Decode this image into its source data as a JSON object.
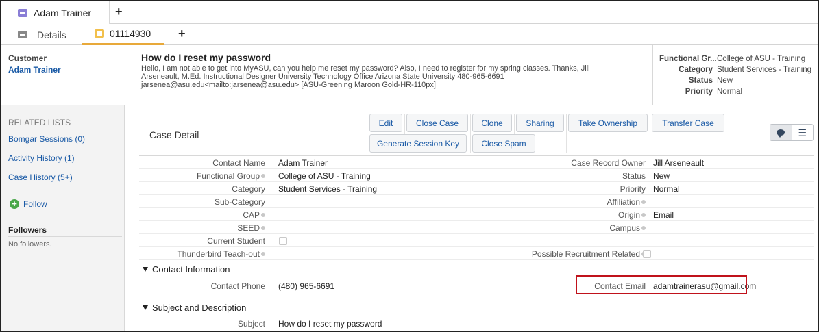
{
  "primary_tab": {
    "label": "Adam Trainer"
  },
  "subtabs": {
    "details": "Details",
    "case": "01114930"
  },
  "highlights": {
    "customer_label": "Customer",
    "customer_name": "Adam Trainer",
    "subject": "How do I reset my password",
    "description_lines": [
      "Hello, I am not able to get into MyASU, can you help me reset my password? Also, I need to register for my spring classes. Thanks, Jill",
      "Arseneault, M.Ed. Instructional Designer University Technology Office Arizona State University 480-965-6691",
      "jarsenea@asu.edu<mailto:jarsenea@asu.edu> [ASU-Greening Maroon Gold-HR-110px]"
    ],
    "fields": [
      {
        "label": "Functional Gr...",
        "value": "College of ASU - Training"
      },
      {
        "label": "Category",
        "value": "Student Services - Training"
      },
      {
        "label": "Status",
        "value": "New"
      },
      {
        "label": "Priority",
        "value": "Normal"
      }
    ]
  },
  "sidebar": {
    "heading": "RELATED LISTS",
    "links": [
      "Bomgar Sessions (0)",
      "Activity History (1)",
      "Case History (5+)"
    ],
    "follow": "Follow",
    "followers_heading": "Followers",
    "followers_value": "No followers."
  },
  "case_detail": {
    "title": "Case Detail",
    "buttons": {
      "edit": "Edit",
      "close_case": "Close Case",
      "clone": "Clone",
      "sharing": "Sharing",
      "take_ownership": "Take Ownership",
      "transfer_case": "Transfer Case",
      "generate_session_key": "Generate Session Key",
      "close_spam": "Close Spam"
    },
    "rows": [
      {
        "left_label": "Contact Name",
        "left_value": "Adam Trainer",
        "right_label": "Case Record Owner",
        "right_value": "Jill Arseneault"
      },
      {
        "left_label": "Functional Group",
        "left_value": "College of ASU - Training",
        "right_label": "Status",
        "right_value": "New"
      },
      {
        "left_label": "Category",
        "left_value": "Student Services - Training",
        "right_label": "Priority",
        "right_value": "Normal"
      },
      {
        "left_label": "Sub-Category",
        "left_value": "",
        "right_label": "Affiliation",
        "right_value": ""
      },
      {
        "left_label": "CAP",
        "left_value": "",
        "right_label": "Origin",
        "right_value": "Email"
      },
      {
        "left_label": "SEED",
        "left_value": "",
        "right_label": "Campus",
        "right_value": ""
      },
      {
        "left_label": "Current Student",
        "left_value": "",
        "right_label": "",
        "right_value": ""
      },
      {
        "left_label": "Thunderbird Teach-out",
        "left_value": "",
        "right_label": "Possible Recruitment Related",
        "right_value": ""
      }
    ],
    "contact_section": {
      "heading": "Contact Information",
      "phone_label": "Contact Phone",
      "phone_value": "(480) 965-6691",
      "email_label": "Contact Email",
      "email_value": "adamtrainerasu@gmail.com"
    },
    "subject_section": {
      "heading": "Subject and Description",
      "subject_label": "Subject",
      "subject_value": "How do I reset my password"
    }
  },
  "colors": {
    "link": "#1a5aa6",
    "highlight_box": "#c0121b",
    "case_tab_accent": "#e8a93a"
  }
}
